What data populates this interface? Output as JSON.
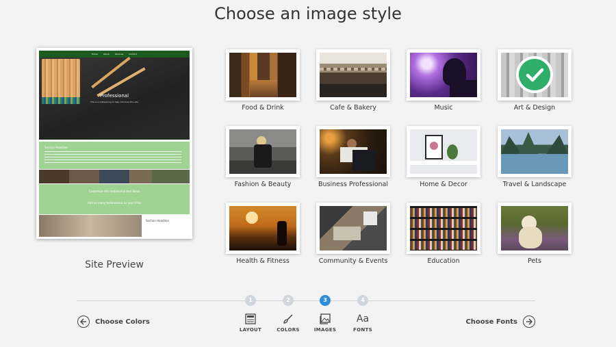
{
  "page": {
    "title": "Choose an image style"
  },
  "preview": {
    "label": "Site Preview",
    "nav_items": [
      "Home",
      "About",
      "Services",
      "Contact"
    ],
    "hero_title": "Professional",
    "hero_subtitle": "This is a subheading to help introduce this site",
    "section_heading": "Section Headline",
    "quote_1": "Customize this testimonial text block",
    "quote_2": "Add as many testimonials as you'd like",
    "section_heading_2": "Section Headline"
  },
  "styles": [
    {
      "label": "Food & Drink",
      "selected": false
    },
    {
      "label": "Cafe & Bakery",
      "selected": false
    },
    {
      "label": "Music",
      "selected": false
    },
    {
      "label": "Art & Design",
      "selected": true
    },
    {
      "label": "Fashion & Beauty",
      "selected": false
    },
    {
      "label": "Business Professional",
      "selected": false
    },
    {
      "label": "Home & Decor",
      "selected": false
    },
    {
      "label": "Travel & Landscape",
      "selected": false
    },
    {
      "label": "Health & Fitness",
      "selected": false
    },
    {
      "label": "Community & Events",
      "selected": false
    },
    {
      "label": "Education",
      "selected": false
    },
    {
      "label": "Pets",
      "selected": false
    }
  ],
  "steps": [
    {
      "number": "1",
      "label": "LAYOUT",
      "icon": "layout-icon",
      "active": false
    },
    {
      "number": "2",
      "label": "COLORS",
      "icon": "brush-icon",
      "active": false
    },
    {
      "number": "3",
      "label": "IMAGES",
      "icon": "images-icon",
      "active": true
    },
    {
      "number": "4",
      "label": "FONTS",
      "icon": "fonts-icon",
      "active": false,
      "glyph": "Aa"
    }
  ],
  "nav": {
    "prev_label": "Choose Colors",
    "next_label": "Choose Fonts"
  },
  "colors": {
    "accent": "#2d8ee0",
    "check": "#2fae6a",
    "preview_green": "#9fd394"
  }
}
